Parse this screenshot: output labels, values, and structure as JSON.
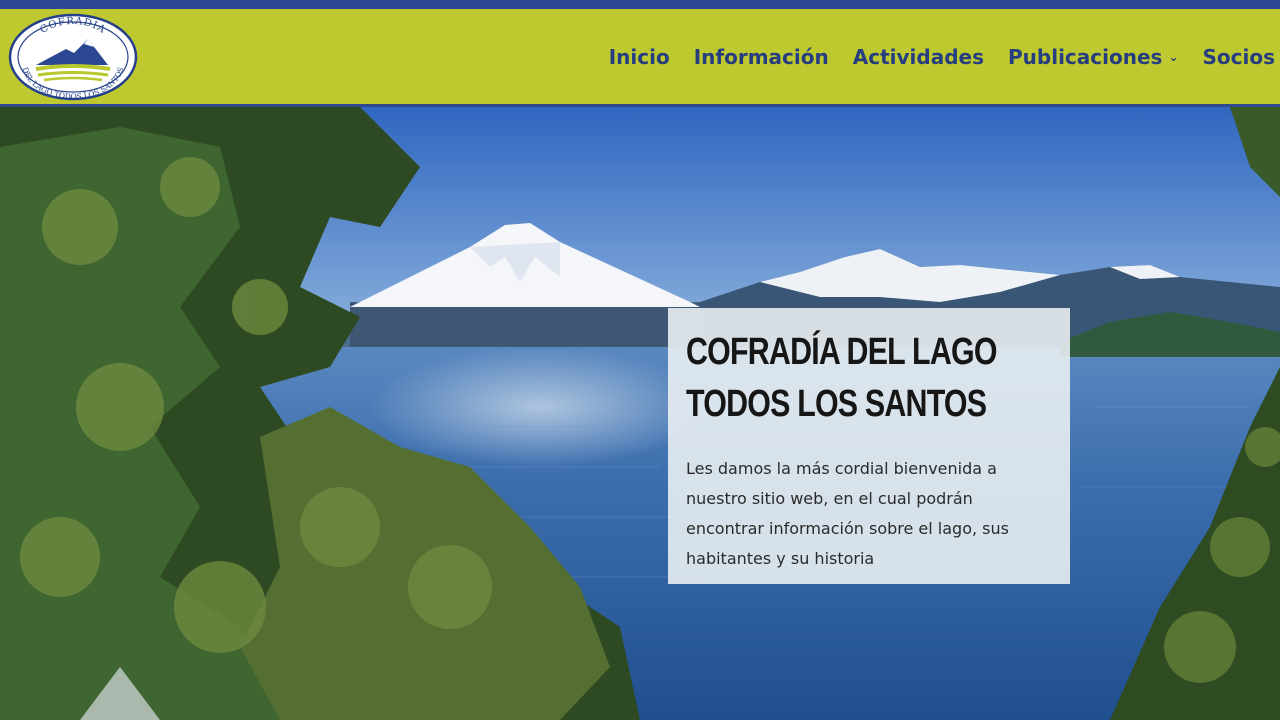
{
  "header": {
    "logo": {
      "top_text": "COFRADIA",
      "bottom_text": "DEL LAGO TODOS LOS SANTOS"
    },
    "nav": [
      {
        "label": "Inicio",
        "icon": null
      },
      {
        "label": "Información",
        "icon": null
      },
      {
        "label": "Actividades",
        "icon": null
      },
      {
        "label": "Publicaciones",
        "icon": "chevron-down-icon"
      },
      {
        "label": "Socios",
        "icon": null
      }
    ]
  },
  "hero": {
    "title": "COFRADÍA DEL LAGO TODOS LOS SANTOS",
    "text": "Les damos la más cordial bienvenida a nuestro sitio web, en el cual podrán encontrar información sobre el lago, sus habitantes y su historia"
  },
  "colors": {
    "top_bar": "#2b4791",
    "header_bg": "#bdc92e",
    "nav_text": "#263d80",
    "sky": "#3f78c8",
    "lake": "#2d62a0",
    "card_bg": "rgba(233,238,242,0.9)"
  }
}
